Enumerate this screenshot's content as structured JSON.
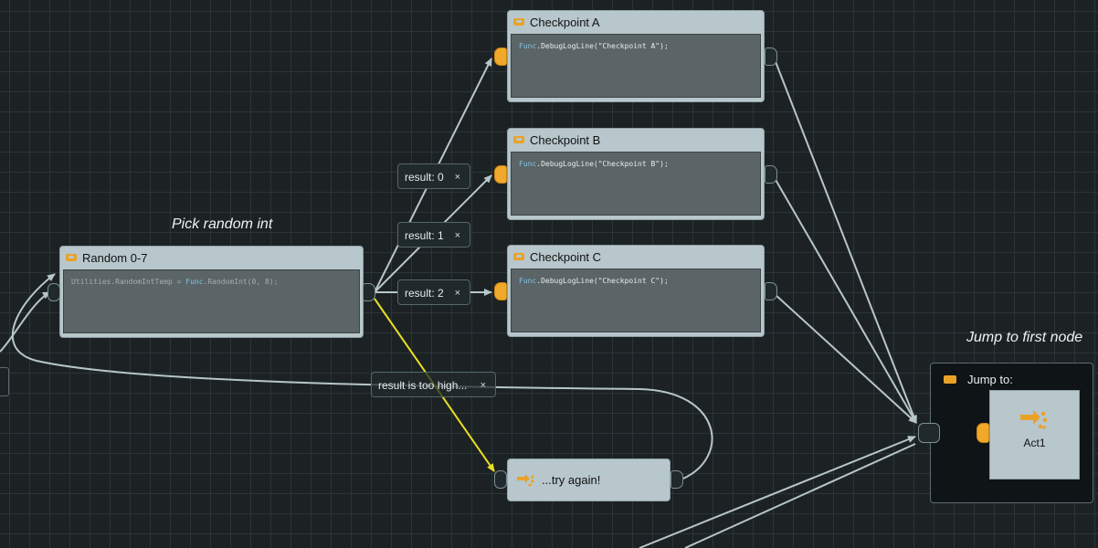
{
  "comments": {
    "pick_random": "Pick random int",
    "jump_first": "Jump to first node"
  },
  "nodes": {
    "random": {
      "title": "Random 0-7",
      "code_class1": "Utilities",
      "code_mid1": ".RandomIntTemp = ",
      "code_class2": "Func",
      "code_mid2": ".RandomInt(0, 8);"
    },
    "checkpoint_a": {
      "title": "Checkpoint A",
      "code_class": "Func",
      "code_rest": ".DebugLogLine(\"Checkpoint A\");"
    },
    "checkpoint_b": {
      "title": "Checkpoint B",
      "code_class": "Func",
      "code_rest": ".DebugLogLine(\"Checkpoint B\");"
    },
    "checkpoint_c": {
      "title": "Checkpoint C",
      "code_class": "Func",
      "code_rest": ".DebugLogLine(\"Checkpoint C\");"
    },
    "retry": {
      "title": "...try again!"
    },
    "jump": {
      "title": "Jump to:",
      "target": "Act1"
    }
  },
  "conditions": [
    {
      "label": "result: 0",
      "close": "×"
    },
    {
      "label": "result: 1",
      "close": "×"
    },
    {
      "label": "result: 2",
      "close": "×"
    },
    {
      "label": "result is too high...",
      "close": "×"
    }
  ],
  "colors": {
    "accent_port": "#f0a92a",
    "yellow_wire": "#e8e023",
    "wire": "#b7c6ca",
    "node_bg": "#b8c7cc"
  }
}
